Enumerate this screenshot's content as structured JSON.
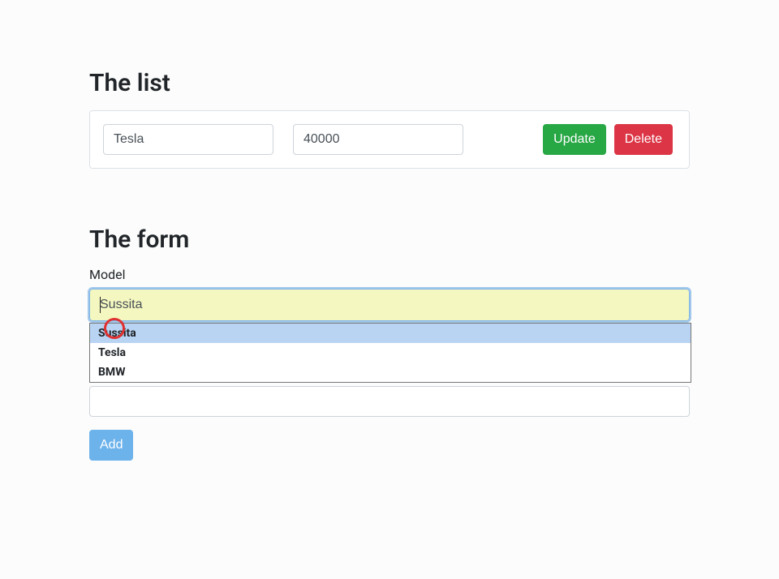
{
  "list": {
    "heading": "The list",
    "items": [
      {
        "name": "Tesla",
        "price": "40000"
      }
    ],
    "update_label": "Update",
    "delete_label": "Delete"
  },
  "form": {
    "heading": "The form",
    "model_label": "Model",
    "model_value": "Sussita",
    "autocomplete_options": [
      "Sussita",
      "Tesla",
      "BMW"
    ],
    "highlighted_index": 0,
    "add_label": "Add"
  },
  "annotation": {
    "type": "red-circle",
    "over": "autocomplete-option-0"
  }
}
